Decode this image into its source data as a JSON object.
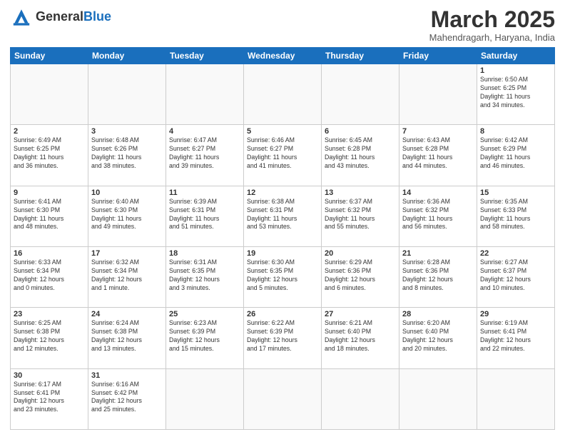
{
  "header": {
    "logo_general": "General",
    "logo_blue": "Blue",
    "month_title": "March 2025",
    "subtitle": "Mahendragarh, Haryana, India"
  },
  "days_of_week": [
    "Sunday",
    "Monday",
    "Tuesday",
    "Wednesday",
    "Thursday",
    "Friday",
    "Saturday"
  ],
  "weeks": [
    [
      {
        "day": "",
        "info": ""
      },
      {
        "day": "",
        "info": ""
      },
      {
        "day": "",
        "info": ""
      },
      {
        "day": "",
        "info": ""
      },
      {
        "day": "",
        "info": ""
      },
      {
        "day": "",
        "info": ""
      },
      {
        "day": "1",
        "info": "Sunrise: 6:50 AM\nSunset: 6:25 PM\nDaylight: 11 hours\nand 34 minutes."
      }
    ],
    [
      {
        "day": "2",
        "info": "Sunrise: 6:49 AM\nSunset: 6:25 PM\nDaylight: 11 hours\nand 36 minutes."
      },
      {
        "day": "3",
        "info": "Sunrise: 6:48 AM\nSunset: 6:26 PM\nDaylight: 11 hours\nand 38 minutes."
      },
      {
        "day": "4",
        "info": "Sunrise: 6:47 AM\nSunset: 6:27 PM\nDaylight: 11 hours\nand 39 minutes."
      },
      {
        "day": "5",
        "info": "Sunrise: 6:46 AM\nSunset: 6:27 PM\nDaylight: 11 hours\nand 41 minutes."
      },
      {
        "day": "6",
        "info": "Sunrise: 6:45 AM\nSunset: 6:28 PM\nDaylight: 11 hours\nand 43 minutes."
      },
      {
        "day": "7",
        "info": "Sunrise: 6:43 AM\nSunset: 6:28 PM\nDaylight: 11 hours\nand 44 minutes."
      },
      {
        "day": "8",
        "info": "Sunrise: 6:42 AM\nSunset: 6:29 PM\nDaylight: 11 hours\nand 46 minutes."
      }
    ],
    [
      {
        "day": "9",
        "info": "Sunrise: 6:41 AM\nSunset: 6:30 PM\nDaylight: 11 hours\nand 48 minutes."
      },
      {
        "day": "10",
        "info": "Sunrise: 6:40 AM\nSunset: 6:30 PM\nDaylight: 11 hours\nand 49 minutes."
      },
      {
        "day": "11",
        "info": "Sunrise: 6:39 AM\nSunset: 6:31 PM\nDaylight: 11 hours\nand 51 minutes."
      },
      {
        "day": "12",
        "info": "Sunrise: 6:38 AM\nSunset: 6:31 PM\nDaylight: 11 hours\nand 53 minutes."
      },
      {
        "day": "13",
        "info": "Sunrise: 6:37 AM\nSunset: 6:32 PM\nDaylight: 11 hours\nand 55 minutes."
      },
      {
        "day": "14",
        "info": "Sunrise: 6:36 AM\nSunset: 6:32 PM\nDaylight: 11 hours\nand 56 minutes."
      },
      {
        "day": "15",
        "info": "Sunrise: 6:35 AM\nSunset: 6:33 PM\nDaylight: 11 hours\nand 58 minutes."
      }
    ],
    [
      {
        "day": "16",
        "info": "Sunrise: 6:33 AM\nSunset: 6:34 PM\nDaylight: 12 hours\nand 0 minutes."
      },
      {
        "day": "17",
        "info": "Sunrise: 6:32 AM\nSunset: 6:34 PM\nDaylight: 12 hours\nand 1 minute."
      },
      {
        "day": "18",
        "info": "Sunrise: 6:31 AM\nSunset: 6:35 PM\nDaylight: 12 hours\nand 3 minutes."
      },
      {
        "day": "19",
        "info": "Sunrise: 6:30 AM\nSunset: 6:35 PM\nDaylight: 12 hours\nand 5 minutes."
      },
      {
        "day": "20",
        "info": "Sunrise: 6:29 AM\nSunset: 6:36 PM\nDaylight: 12 hours\nand 6 minutes."
      },
      {
        "day": "21",
        "info": "Sunrise: 6:28 AM\nSunset: 6:36 PM\nDaylight: 12 hours\nand 8 minutes."
      },
      {
        "day": "22",
        "info": "Sunrise: 6:27 AM\nSunset: 6:37 PM\nDaylight: 12 hours\nand 10 minutes."
      }
    ],
    [
      {
        "day": "23",
        "info": "Sunrise: 6:25 AM\nSunset: 6:38 PM\nDaylight: 12 hours\nand 12 minutes."
      },
      {
        "day": "24",
        "info": "Sunrise: 6:24 AM\nSunset: 6:38 PM\nDaylight: 12 hours\nand 13 minutes."
      },
      {
        "day": "25",
        "info": "Sunrise: 6:23 AM\nSunset: 6:39 PM\nDaylight: 12 hours\nand 15 minutes."
      },
      {
        "day": "26",
        "info": "Sunrise: 6:22 AM\nSunset: 6:39 PM\nDaylight: 12 hours\nand 17 minutes."
      },
      {
        "day": "27",
        "info": "Sunrise: 6:21 AM\nSunset: 6:40 PM\nDaylight: 12 hours\nand 18 minutes."
      },
      {
        "day": "28",
        "info": "Sunrise: 6:20 AM\nSunset: 6:40 PM\nDaylight: 12 hours\nand 20 minutes."
      },
      {
        "day": "29",
        "info": "Sunrise: 6:19 AM\nSunset: 6:41 PM\nDaylight: 12 hours\nand 22 minutes."
      }
    ],
    [
      {
        "day": "30",
        "info": "Sunrise: 6:17 AM\nSunset: 6:41 PM\nDaylight: 12 hours\nand 23 minutes."
      },
      {
        "day": "31",
        "info": "Sunrise: 6:16 AM\nSunset: 6:42 PM\nDaylight: 12 hours\nand 25 minutes."
      },
      {
        "day": "",
        "info": ""
      },
      {
        "day": "",
        "info": ""
      },
      {
        "day": "",
        "info": ""
      },
      {
        "day": "",
        "info": ""
      },
      {
        "day": "",
        "info": ""
      }
    ]
  ]
}
